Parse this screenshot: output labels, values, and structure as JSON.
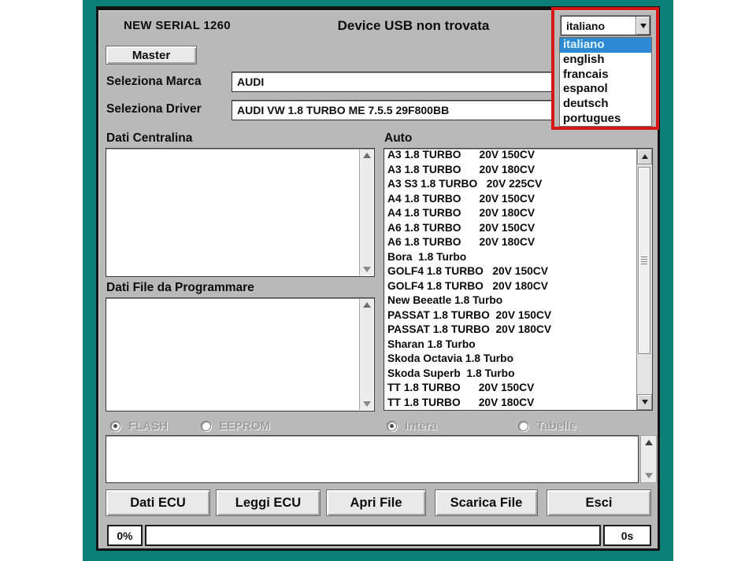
{
  "colors": {
    "teal": "#0a8078",
    "windowgray": "#b9b9b9",
    "highlight": "#2d8ad2",
    "alertred": "#d61717"
  },
  "header": {
    "serial_label": "NEW SERIAL 1260",
    "status_message": "Device USB non trovata",
    "master_button": "Master"
  },
  "language": {
    "selected": "italiano",
    "options": [
      "italiano",
      "english",
      "francais",
      "espanol",
      "deutsch",
      "portugues"
    ],
    "highlighted_option": "italiano"
  },
  "marca": {
    "label": "Seleziona Marca",
    "value": "AUDI"
  },
  "driver": {
    "label": "Seleziona Driver",
    "value": "AUDI VW 1.8 TURBO ME 7.5.5 29F800BB"
  },
  "sections": {
    "dati_centralina": "Dati Centralina",
    "auto": "Auto",
    "dati_file": "Dati File da Programmare"
  },
  "auto_list": [
    "A3 1.8 TURBO      20V 150CV",
    "A3 1.8 TURBO      20V 180CV",
    "A3 S3 1.8 TURBO   20V 225CV",
    "A4 1.8 TURBO      20V 150CV",
    "A4 1.8 TURBO      20V 180CV",
    "A6 1.8 TURBO      20V 150CV",
    "A6 1.8 TURBO      20V 180CV",
    "Bora  1.8 Turbo",
    "GOLF4 1.8 TURBO   20V 150CV",
    "GOLF4 1.8 TURBO   20V 180CV",
    "New Beeatle 1.8 Turbo",
    "PASSAT 1.8 TURBO  20V 150CV",
    "PASSAT 1.8 TURBO  20V 180CV",
    "Sharan 1.8 Turbo",
    "Skoda Octavia 1.8 Turbo",
    "Skoda Superb  1.8 Turbo",
    "TT 1.8 TURBO      20V 150CV",
    "TT 1.8 TURBO      20V 180CV"
  ],
  "radios": [
    {
      "label": "FLASH",
      "selected": true
    },
    {
      "label": "EEPROM",
      "selected": false
    },
    {
      "label": "Intera",
      "selected": true
    },
    {
      "label": "Tabelle",
      "selected": false
    }
  ],
  "action_buttons": [
    "Dati ECU",
    "Leggi ECU",
    "Apri File",
    "Scarica File",
    "Esci"
  ],
  "progress": {
    "percent": "0%",
    "time": "0s"
  }
}
